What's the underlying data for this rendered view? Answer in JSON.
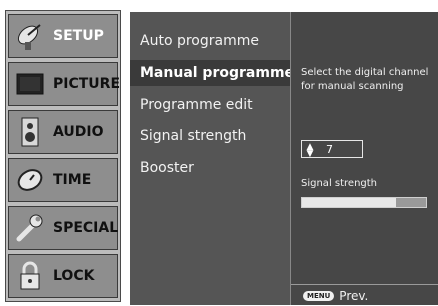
{
  "left_menu": {
    "items": [
      {
        "label": "SETUP",
        "icon": "satellite-dish-icon",
        "active": true
      },
      {
        "label": "PICTURE",
        "icon": "monitor-icon"
      },
      {
        "label": "AUDIO",
        "icon": "speaker-icon"
      },
      {
        "label": "TIME",
        "icon": "clock-icon"
      },
      {
        "label": "SPECIAL",
        "icon": "wrench-icon"
      },
      {
        "label": "LOCK",
        "icon": "padlock-icon"
      }
    ]
  },
  "sub_menu": {
    "items": [
      {
        "label": "Auto programme"
      },
      {
        "label": "Manual programme",
        "selected": true,
        "arrow": "▸"
      },
      {
        "label": "Programme edit"
      },
      {
        "label": "Signal strength"
      },
      {
        "label": "Booster"
      }
    ]
  },
  "info_panel": {
    "description": "Select the digital channel for manual scanning",
    "channel_value": "7",
    "channel_arrows": "▲▼",
    "signal_label": "Signal strength",
    "signal_level_percent": 76,
    "footer": {
      "key_label": "MENU",
      "action_label": "Prev."
    }
  },
  "colors": {
    "left_menu_bg": "#bcbcbc",
    "left_item_bg": "#8e8e8e",
    "sub_menu_bg": "#555555",
    "info_panel_bg": "#474747"
  }
}
